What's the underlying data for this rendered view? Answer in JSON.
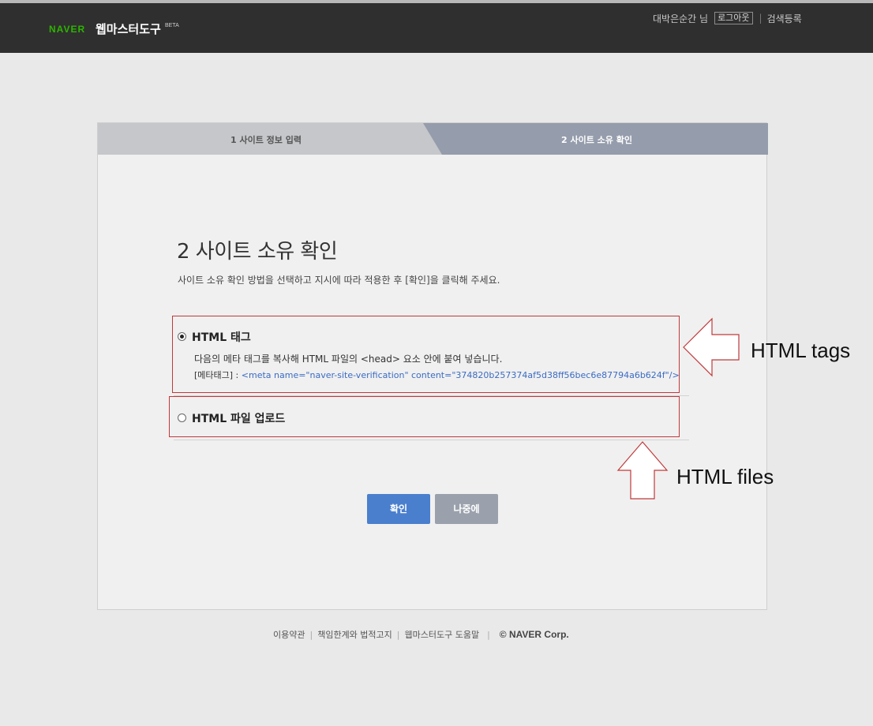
{
  "header": {
    "logo_text": "NAVER",
    "service_name": "웹마스터도구",
    "beta_label": "BETA",
    "user_name": "대박은순간 님",
    "logout_label": "로그아웃",
    "search_register_label": "검색등록"
  },
  "steps": {
    "step1_label": "1 사이트 정보 입력",
    "step2_label": "2 사이트 소유 확인"
  },
  "main": {
    "title": "2 사이트 소유 확인",
    "description": "사이트 소유 확인 방법을 선택하고 지시에 따라 적용한 후 [확인]을 클릭해 주세요.",
    "options": [
      {
        "label": "HTML 태그",
        "selected": true,
        "description": "다음의 메타 태그를 복사해 HTML 파일의 <head> 요소 안에 붙여 넣습니다.",
        "meta_prefix": "[메타태그] : ",
        "meta_code": "<meta name=\"naver-site-verification\" content=\"374820b257374af5d38ff56bec6e87794a6b624f\"/>"
      },
      {
        "label": "HTML 파일 업로드",
        "selected": false
      }
    ],
    "confirm_label": "확인",
    "later_label": "나중에"
  },
  "annotations": {
    "tags_label": "HTML tags",
    "files_label": "HTML files"
  },
  "footer": {
    "terms": "이용약관",
    "legal": "책임한계와 법적고지",
    "help": "웹마스터도구 도움말",
    "copyright": "© NAVER Corp."
  },
  "colors": {
    "brand_green": "#2db400",
    "header_bg": "#2f2f2f",
    "active_step": "#959cab",
    "primary_button": "#4a7fce",
    "annotation_red": "#c0393b"
  }
}
